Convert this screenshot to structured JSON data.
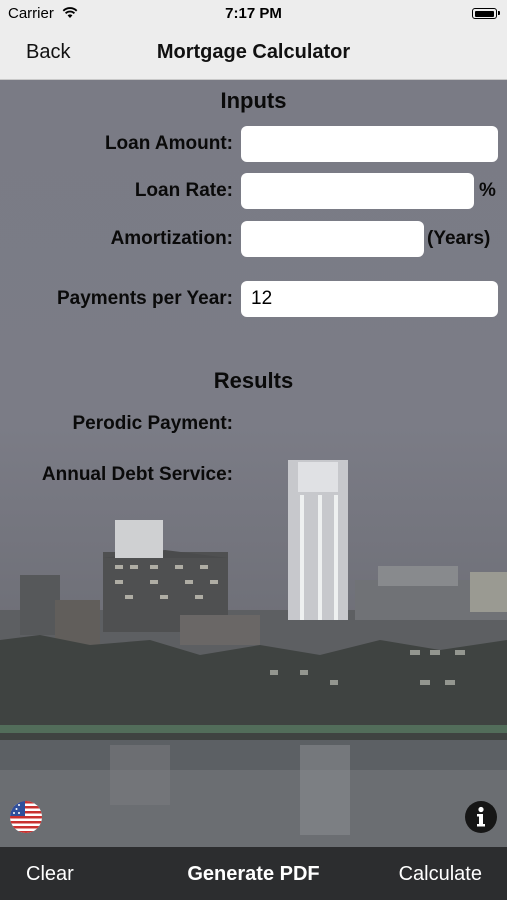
{
  "status": {
    "carrier": "Carrier",
    "time": "7:17 PM",
    "battery_level": 0.95
  },
  "nav": {
    "back": "Back",
    "title": "Mortgage Calculator"
  },
  "inputs": {
    "heading": "Inputs",
    "loan_amount": {
      "label": "Loan Amount:",
      "value": ""
    },
    "loan_rate": {
      "label": "Loan Rate:",
      "value": "",
      "unit": "%"
    },
    "amortization": {
      "label": "Amortization:",
      "value": "",
      "unit": "(Years)"
    },
    "payments_per_year": {
      "label": "Payments per Year:",
      "value": "12"
    }
  },
  "results": {
    "heading": "Results",
    "periodic_payment": {
      "label": "Perodic Payment:"
    },
    "annual_debt_service": {
      "label": "Annual Debt Service:"
    }
  },
  "toolbar": {
    "clear": "Clear",
    "generate_pdf": "Generate PDF",
    "calculate": "Calculate"
  },
  "icons": {
    "flag": "us-flag-icon",
    "info": "info-icon"
  },
  "colors": {
    "bar": "#ededed",
    "toolbar": "#2c2d2f",
    "background": "#7b7c86"
  }
}
